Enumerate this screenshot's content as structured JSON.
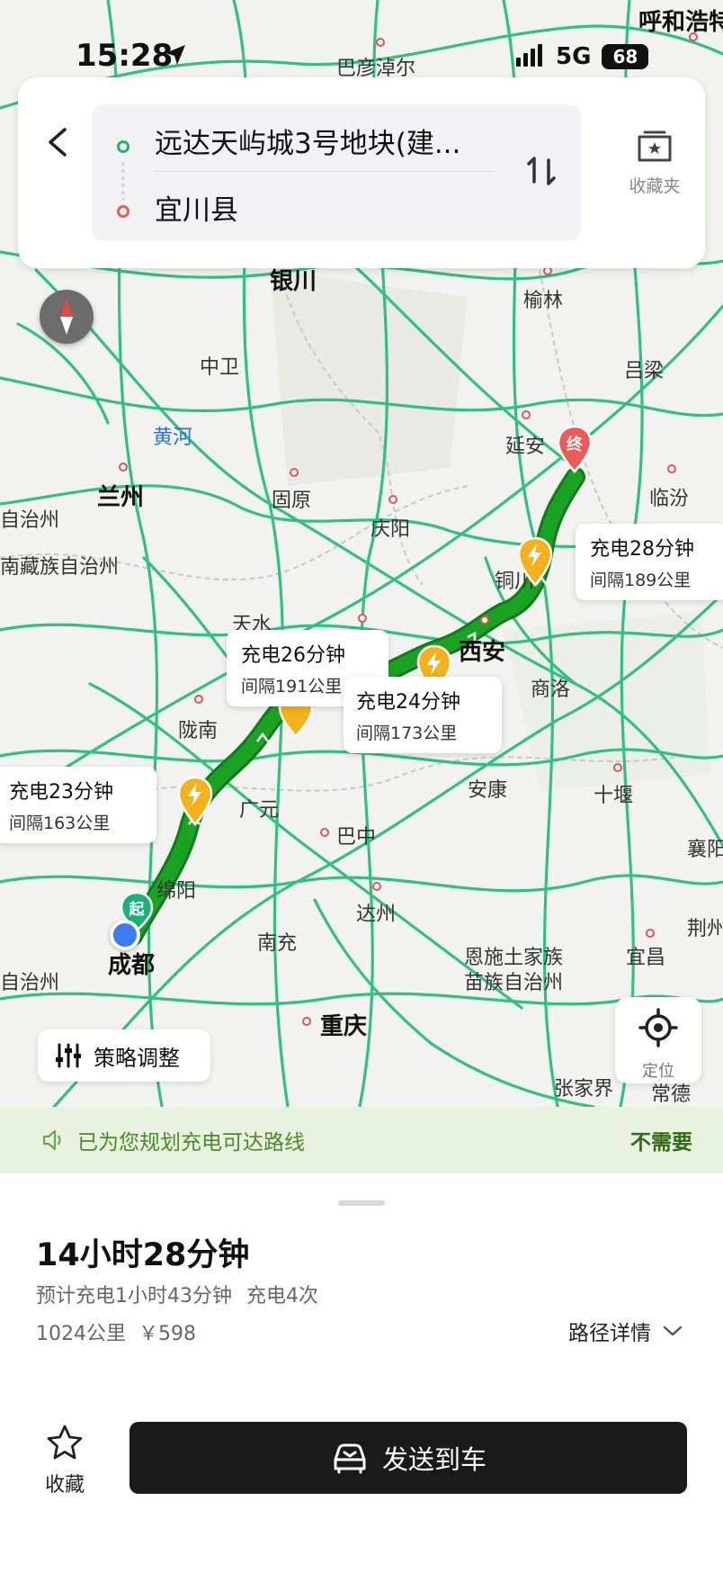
{
  "status_bar": {
    "time": "15:28",
    "network": "5G",
    "battery": "68"
  },
  "route": {
    "from": "远达天屿城3号地块(建...",
    "to": "宜川县",
    "favorites_label": "收藏夹"
  },
  "map": {
    "cities": {
      "hohhot": "呼和浩特",
      "bayannur": "巴彦淖尔",
      "yinchuan": "银川",
      "yulin": "榆林",
      "zhongwei": "中卫",
      "lvliang": "吕梁",
      "yellow_river": "黄河",
      "yanan": "延安",
      "lanzhou": "兰州",
      "guyuan": "固原",
      "qingyang": "庆阳",
      "linfen": "临汾",
      "zizhizhou_left": "自治州",
      "gannan": "南藏族自治州",
      "tongchuan": "铜川",
      "tianshui": "天水",
      "xian": "西安",
      "shangluo": "商洛",
      "longnan": "陇南",
      "ankang": "安康",
      "shiyan": "十堰",
      "guangyuan": "广元",
      "bazhong": "巴中",
      "xiangyang": "襄阳",
      "mianyang": "绵阳",
      "dazhou": "达州",
      "nanchong": "南充",
      "chengdu": "成都",
      "enshi_1": "恩施土家族",
      "enshi_2": "苗族自治州",
      "yichang": "宜昌",
      "jingzhou": "荆州",
      "zizhizhou_bottom": "自治州",
      "chongqing": "重庆",
      "zhangjiajie": "张家界",
      "changde": "常德"
    },
    "end_marker": "终",
    "start_marker": "起",
    "charging_stops": [
      {
        "time": "充电28分钟",
        "interval": "间隔189公里"
      },
      {
        "time": "充电26分钟",
        "interval": "间隔191公里"
      },
      {
        "time": "充电24分钟",
        "interval": "间隔173公里"
      },
      {
        "time": "充电23分钟",
        "interval": "间隔163公里"
      }
    ],
    "strategy_label": "策略调整",
    "locate_label": "定位",
    "colors": {
      "road": "#2ec27e",
      "route": "#1aa322",
      "charger": "#f3b21b",
      "end": "#ee5a55"
    }
  },
  "notice": {
    "text": "已为您规划充电可达路线",
    "dismiss": "不需要"
  },
  "summary": {
    "duration": "14小时28分钟",
    "charge_time": "预计充电1小时43分钟",
    "charge_count": "充电4次",
    "distance": "1024公里",
    "cost": "￥598",
    "details_label": "路径详情",
    "favorite_label": "收藏",
    "send_label": "发送到车"
  }
}
